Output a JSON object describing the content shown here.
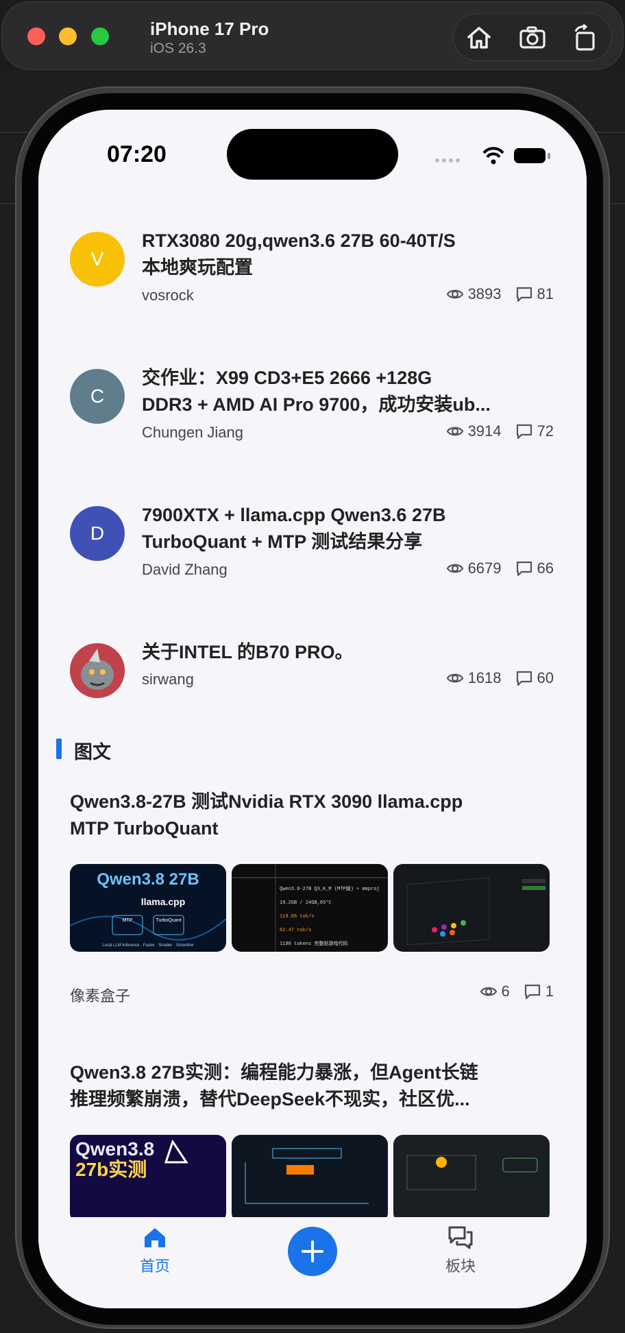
{
  "simulator": {
    "device_name": "iPhone 17 Pro",
    "os_version": "iOS 26.3",
    "tools": [
      "home-icon",
      "screenshot-icon",
      "rotate-icon"
    ]
  },
  "status_bar": {
    "time": "07:20",
    "icons": [
      "signal-icon",
      "wifi-icon",
      "battery-icon"
    ]
  },
  "posts": [
    {
      "avatar_letter": "V",
      "avatar_color": "#f8c107",
      "title_line1": "RTX3080 20g,qwen3.6 27B 60-40T/S",
      "title_line2": "本地爽玩配置",
      "author": "vosrock",
      "views": "3893",
      "comments": "81"
    },
    {
      "avatar_letter": "C",
      "avatar_color": "#607d8b",
      "title_line1": "交作业：X99 CD3+E5 2666 +128G",
      "title_line2": "DDR3 + AMD AI Pro 9700，成功安装ub...",
      "author": "Chungen Jiang",
      "views": "3914",
      "comments": "72"
    },
    {
      "avatar_letter": "D",
      "avatar_color": "#3f51b5",
      "title_line1": "7900XTX + llama.cpp Qwen3.6 27B",
      "title_line2": "TurboQuant + MTP 测试结果分享",
      "author": "David Zhang",
      "views": "6679",
      "comments": "66"
    },
    {
      "avatar_letter": "",
      "avatar_color": "#b0303a",
      "title_line1": "关于INTEL 的B70 PRO。",
      "title_line2": "",
      "author": "sirwang",
      "views": "1618",
      "comments": "60"
    }
  ],
  "section": {
    "title": "图文"
  },
  "image_posts": [
    {
      "title_line1": "Qwen3.8-27B 测试Nvidia RTX 3090  llama.cpp",
      "title_line2": "MTP TurboQuant",
      "thumb1": {
        "heading": "Qwen3.8 27B",
        "sub": "llama.cpp",
        "badge1": "MTP",
        "badge2": "TurboQuant",
        "footer": "Local LLM Inference · Faster · Smaller · Smoother"
      },
      "thumb2": {
        "lines": [
          "Qwen3.8-27B Q3_K_M (MTP版) + mmproj",
          "19.2GB / 24GB,65°C",
          "119.86 tok/s",
          "62.47 tok/s",
          "1190 tokens 完整贴游戏代码"
        ]
      },
      "author": "像素盒子",
      "views": "6",
      "comments": "1"
    },
    {
      "title_line1": "Qwen3.8 27B实测：编程能力暴涨，但Agent长链",
      "title_line2": "推理频繁崩溃，替代DeepSeek不现实，社区优...",
      "thumb1": {
        "heading": "Qwen3.8",
        "sub": "27b实测"
      }
    }
  ],
  "tabbar": {
    "home_label": "首页",
    "boards_label": "板块",
    "active_color": "#1a73e8"
  }
}
